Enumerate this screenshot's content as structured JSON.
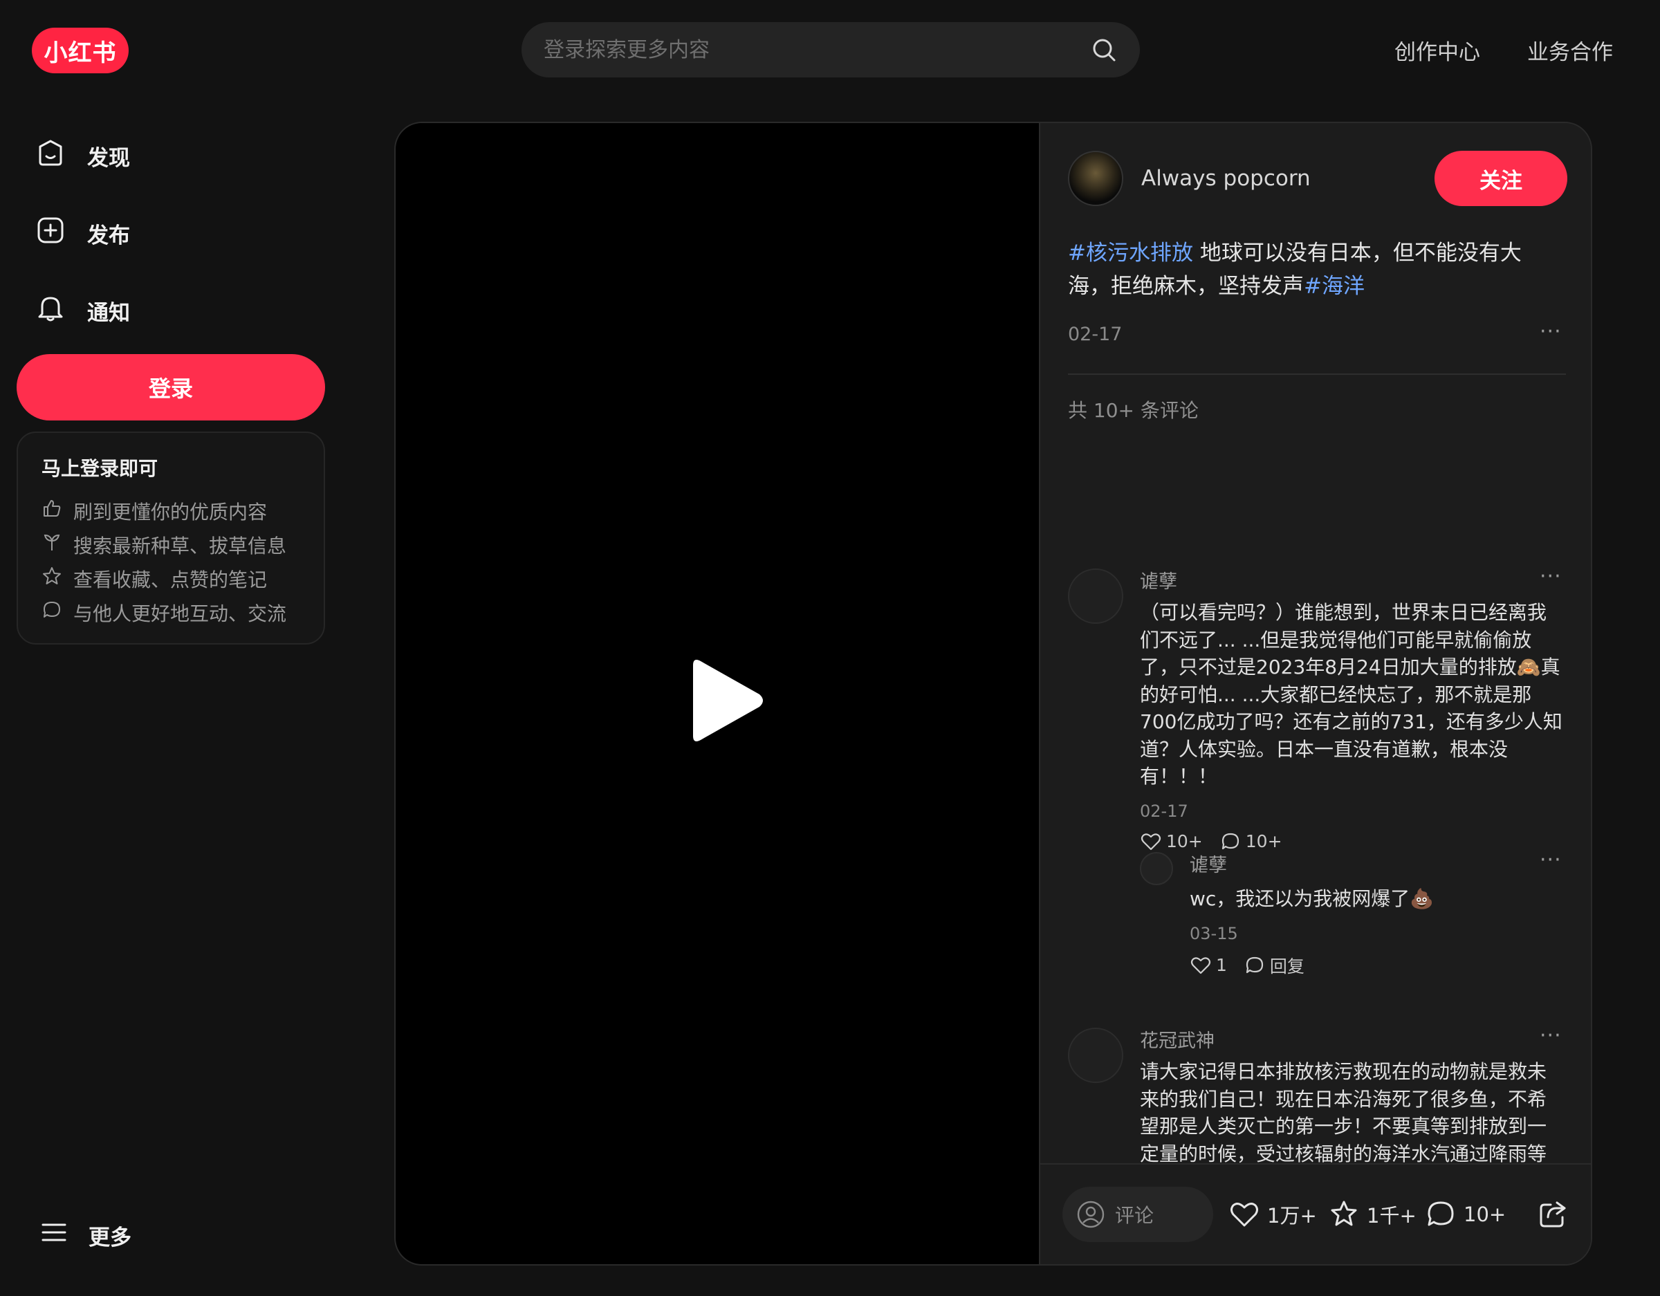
{
  "header": {
    "logo": "小红书",
    "search_placeholder": "登录探索更多内容",
    "links": [
      "创作中心",
      "业务合作"
    ]
  },
  "sidebar": {
    "items": [
      {
        "label": "发现",
        "icon": "home-icon"
      },
      {
        "label": "发布",
        "icon": "plus-square-icon"
      },
      {
        "label": "通知",
        "icon": "bell-icon"
      }
    ],
    "login_label": "登录",
    "login_card": {
      "title": "马上登录即可",
      "benefits": [
        {
          "text": "刷到更懂你的优质内容",
          "icon": "thumbs-up-icon"
        },
        {
          "text": "搜索最新种草、拔草信息",
          "icon": "sprout-icon"
        },
        {
          "text": "查看收藏、点赞的笔记",
          "icon": "star-icon"
        },
        {
          "text": "与他人更好地互动、交流",
          "icon": "chat-bubble-icon"
        }
      ]
    },
    "more_label": "更多"
  },
  "note": {
    "author": "Always popcorn",
    "follow_label": "关注",
    "desc": {
      "tag1": "#核污水排放",
      "text": " 地球可以没有日本，但不能没有大海，拒绝麻木，坚持发声",
      "tag2": "#海洋"
    },
    "date": "02-17",
    "comment_count": "共 10+ 条评论",
    "comments": [
      {
        "author": "谑孽",
        "text": "（可以看完吗？）谁能想到，世界末日已经离我们不远了... ...但是我觉得他们可能早就偷偷放了，只不过是2023年8月24日加大量的排放🙈真的好可怕... ...大家都已经快忘了，那不就是那700亿成功了吗？还有之前的731，还有多少人知道？人体实验。日本一直没有道歉，根本没有！！！",
        "date": "02-17",
        "likes": "10+",
        "replies": "10+",
        "reply": {
          "author": "谑孽",
          "text": "wc，我还以为我被网爆了💩",
          "date": "03-15",
          "likes": "1",
          "reply_label": "回复"
        }
      },
      {
        "author": "花冠武神",
        "text": "请大家记得日本排放核污救现在的动物就是救未来的我们自己！现在日本沿海死了很多鱼，不希望那是人类灭亡的第一步！不要真等到排放到一定量的时候，受过核辐射的海洋水汽通过降雨等方式落到陆地上，污染整个地球 那时我们喝的水吃的食物甚至呼吸的空气都有核辐射！即便有再高的科技又能把地球每个角落净化一遍么。天地不仁，以万物为刍狗。到灾害真正来临的时候，不会因为我们无辜，我们就会幸免于难的！要知道"
      }
    ],
    "bottom": {
      "comment_placeholder": "评论",
      "likes": "1万+",
      "collects": "1千+",
      "comments": "10+"
    }
  }
}
